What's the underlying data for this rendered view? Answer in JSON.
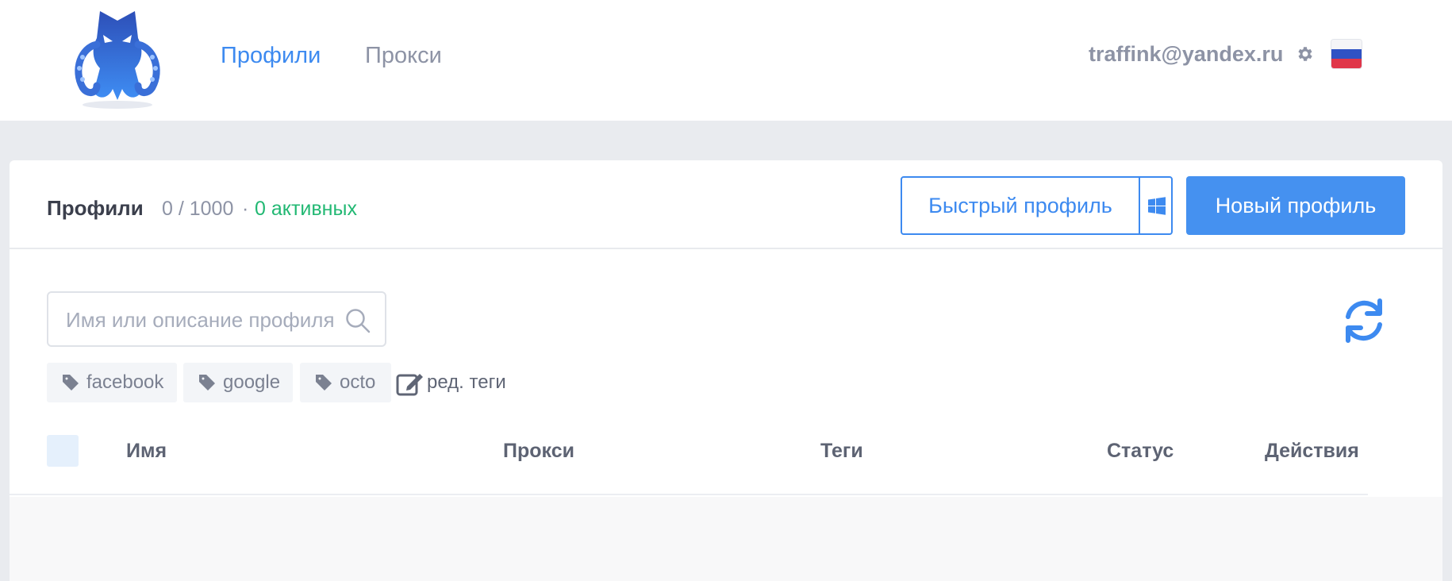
{
  "nav": {
    "profiles_label": "Профили",
    "proxies_label": "Прокси"
  },
  "account": {
    "email": "traffink@yandex.ru",
    "settings_icon": "gear-icon",
    "language_flag": "russia-flag-icon"
  },
  "panel": {
    "title": "Профили",
    "count": "0 / 1000",
    "separator": "·",
    "active": "0 активных",
    "quick_profile_label": "Быстрый профиль",
    "os_icon": "windows-icon",
    "new_profile_label": "Новый профиль"
  },
  "search": {
    "placeholder": "Имя или описание профиля",
    "value": ""
  },
  "tags": [
    {
      "label": "facebook",
      "icon": "tag-icon"
    },
    {
      "label": "google",
      "icon": "tag-icon"
    },
    {
      "label": "octo",
      "icon": "tag-icon"
    }
  ],
  "edit_tags_label": "ред. теги",
  "table": {
    "columns": [
      "Имя",
      "Прокси",
      "Теги",
      "Статус",
      "Действия"
    ],
    "rows": []
  },
  "colors": {
    "accent": "#3d8af0",
    "active_green": "#22b873",
    "muted_text": "#8d93a5"
  }
}
